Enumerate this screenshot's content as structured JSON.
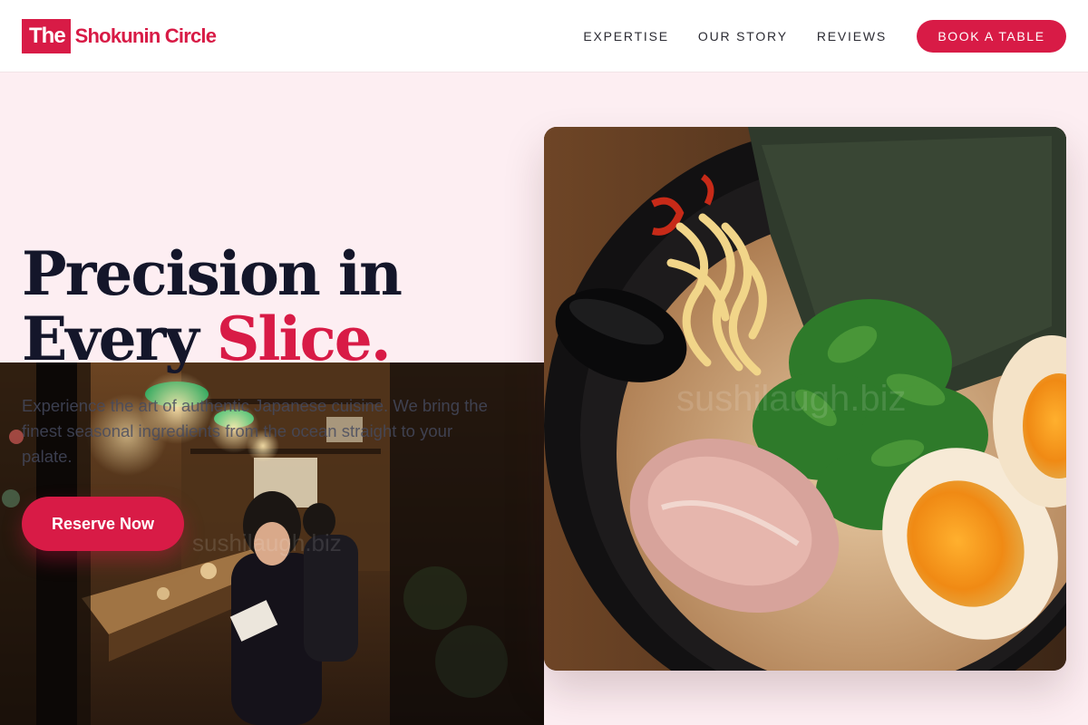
{
  "nav": {
    "logo_box": "The",
    "logo_text": "Shokunin Circle",
    "links": [
      {
        "label": "EXPERTISE"
      },
      {
        "label": "OUR STORY"
      },
      {
        "label": "REVIEWS"
      }
    ],
    "cta_label": "BOOK A TABLE"
  },
  "hero": {
    "title_line1": "Precision in",
    "title_line2_plain": "Every",
    "title_line2_accent": "Slice.",
    "subtitle": "Experience the art of authentic Japanese cuisine. We bring the finest seasonal ingredients from the ocean straight to your palate.",
    "button_label": "Reserve Now"
  },
  "watermarks": {
    "main": "sushilaugh.biz",
    "secondary": "sushilaugh.biz"
  },
  "colors": {
    "brand": "#d81b46",
    "hero_bg": "#fdeef2",
    "heading": "#14162a"
  }
}
